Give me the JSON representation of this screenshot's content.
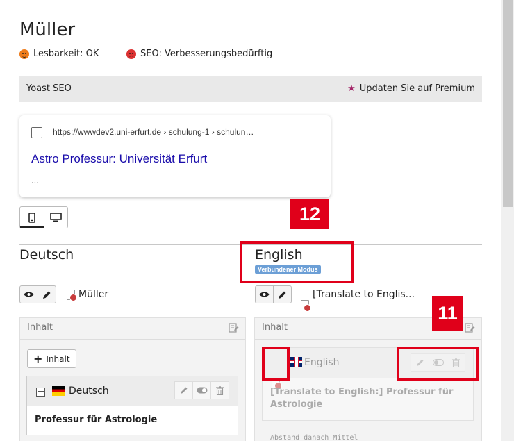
{
  "page": {
    "title": "Müller"
  },
  "scores": {
    "readability": "Lesbarkeit: OK",
    "seo": "SEO: Verbesserungsbedürftig"
  },
  "yoast": {
    "title": "Yoast SEO",
    "premium_link": "Updaten Sie auf Premium"
  },
  "snippet": {
    "url": "https://wwwdev2.uni-erfurt.de › schulung-1 › schulun…",
    "title": "Astro Professur: Universität Erfurt",
    "description": "..."
  },
  "languages": {
    "deutsch": {
      "title": "Deutsch",
      "page_label": "Müller",
      "panel_title": "Inhalt",
      "add_button": "Inhalt",
      "card_language": "Deutsch",
      "card_body": "Professur für Astrologie"
    },
    "english": {
      "title": "English",
      "mode_badge": "Verbundener Modus",
      "page_label": "[Translate to Englis...",
      "panel_title": "Inhalt",
      "card_language": "English",
      "card_body": "[Translate to English:] Professur für Astrologie",
      "spacing": "Abstand danach Mittel"
    }
  },
  "annotations": {
    "tag_12": "12",
    "tag_11": "11"
  },
  "colors": {
    "highlight": "#e0001a",
    "link": "#1a0dab",
    "badge": "#6c9fd6"
  }
}
